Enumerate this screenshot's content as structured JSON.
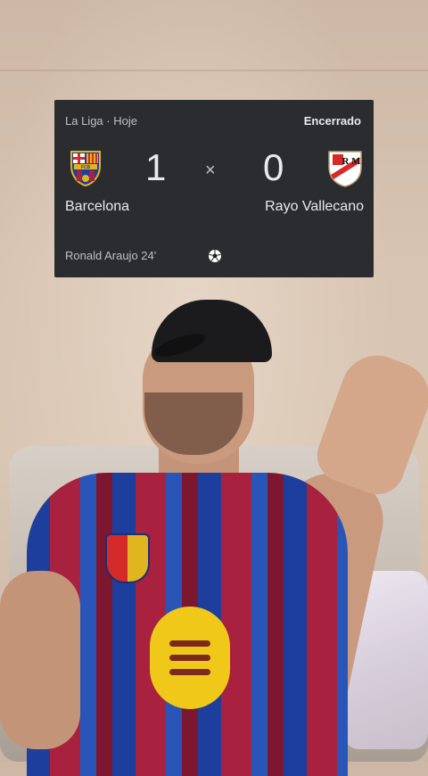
{
  "match": {
    "competition": "La Liga · Hoje",
    "status": "Encerrado",
    "home": {
      "name": "Barcelona",
      "score": "1",
      "crest_text": "FCB"
    },
    "away": {
      "name": "Rayo Vallecano",
      "score": "0",
      "crest_text": "R M"
    },
    "separator": "×",
    "scorer": "Ronald Araujo 24'"
  },
  "icons": {
    "home_logo": "barcelona-crest-icon",
    "away_logo": "rayo-vallecano-crest-icon",
    "goal": "soccer-ball-icon"
  },
  "colors": {
    "card_bg": "#2b2c2f",
    "text_primary": "#e8eaed",
    "text_secondary": "#bdc0c4"
  }
}
